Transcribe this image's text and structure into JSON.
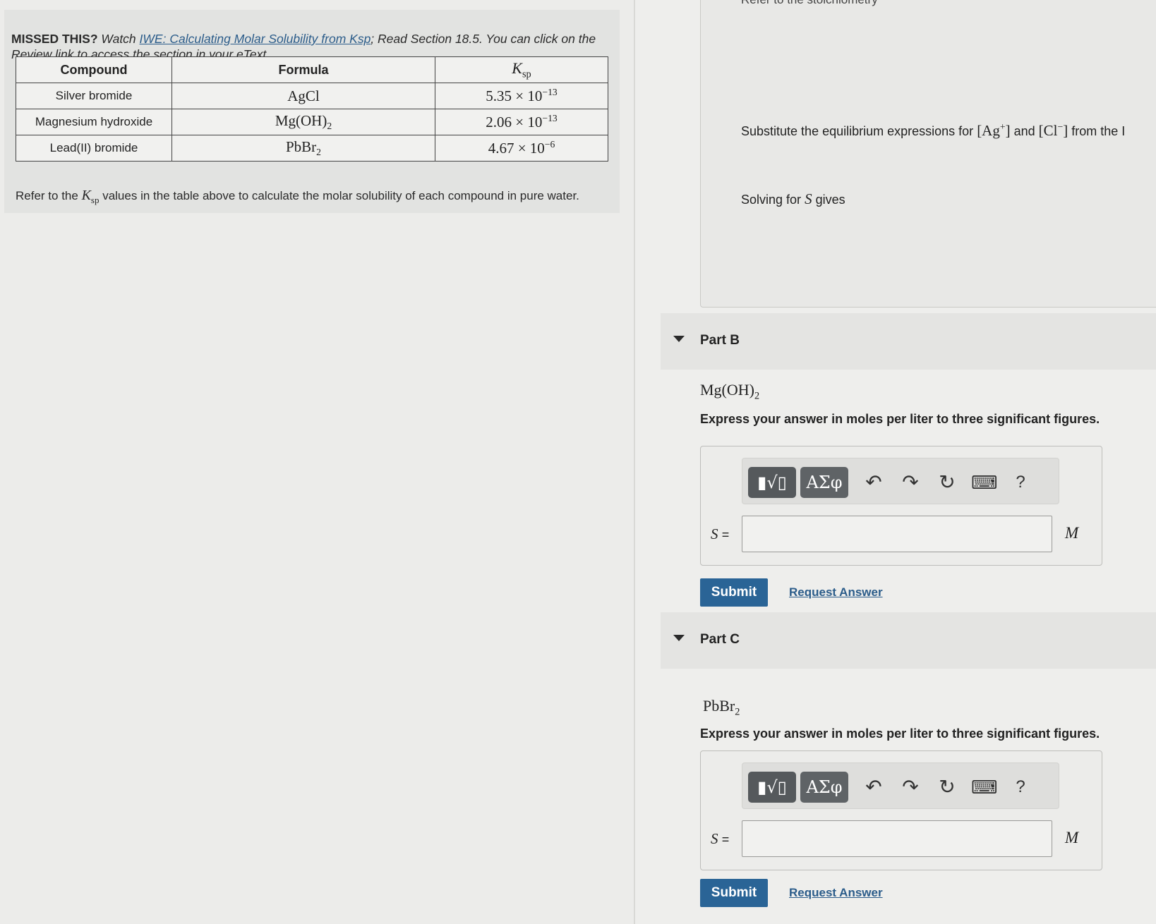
{
  "intro": {
    "missed_label": "MISSED THIS?",
    "watch_prefix": "Watch",
    "video_link": "IWE: Calculating Molar Solubility from Ksp",
    "after_link": "; Read Section 18.5. You can click on the Review link to access the section in your eText."
  },
  "table": {
    "headers": {
      "compound": "Compound",
      "formula": "Formula",
      "ksp_base": "K",
      "ksp_sub": "sp"
    },
    "rows": [
      {
        "compound": "Silver bromide",
        "formula": "AgCl",
        "mant": "5.35 × 10",
        "exp": "−13"
      },
      {
        "compound": "Magnesium hydroxide",
        "formula": "Mg(OH)",
        "formula_sub": "2",
        "mant": "2.06 × 10",
        "exp": "−13"
      },
      {
        "compound": "Lead(II) bromide",
        "formula": "PbBr",
        "formula_sub": "2",
        "mant": "4.67 × 10",
        "exp": "−6"
      }
    ]
  },
  "refer": {
    "prefix": "Refer to the",
    "ksp": "K",
    "ksp_sub": "sp",
    "suffix": "values in the table above to calculate the molar solubility of each compound in pure water."
  },
  "partA": {
    "top_text": "Refer to the stoichiometry",
    "subst_prefix": "Substitute the equilibrium expressions for",
    "ag_ion": "[Ag",
    "ag_charge": "+",
    "bracket_close": "]",
    "and_word": "and",
    "cl_ion": "[Cl",
    "cl_charge": "−",
    "subst_suffix": "from the I",
    "solving_prefix": "Solving for",
    "solving_var": "S",
    "solving_suffix": "gives"
  },
  "parts": [
    {
      "title": "Part B",
      "formula": "Mg(OH)",
      "formula_sub": "2",
      "instruction": "Express your answer in moles per liter to three significant figures.",
      "var_label": "S",
      "equals": "=",
      "input_value": "",
      "unit": "M",
      "submit_label": "Submit",
      "request_label": "Request Answer"
    },
    {
      "title": "Part C",
      "formula": "PbBr",
      "formula_sub": "2",
      "instruction": "Express your answer in moles per liter to three significant figures.",
      "var_label": "S",
      "equals": "=",
      "input_value": "",
      "unit": "M",
      "submit_label": "Submit",
      "request_label": "Request Answer"
    }
  ],
  "toolbar": {
    "greek_label": "ΑΣφ",
    "help_label": "?",
    "icons": [
      "templates-icon",
      "greek-symbols-icon",
      "undo-icon",
      "redo-icon",
      "reset-icon",
      "keyboard-icon",
      "help-icon"
    ]
  },
  "colors": {
    "submit_bg": "#2a6496",
    "link": "#2b5c8a",
    "toolbar_button": "#5f6366"
  }
}
